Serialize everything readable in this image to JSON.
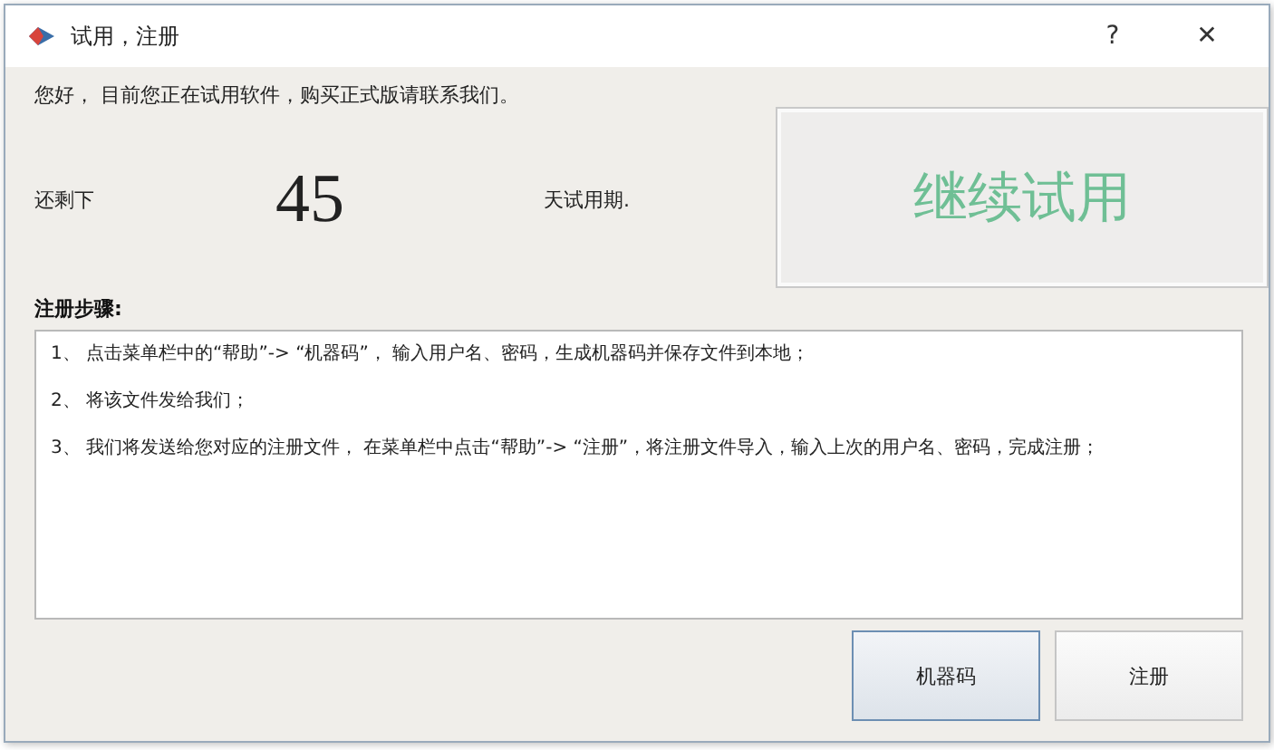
{
  "window": {
    "title": "试用，注册",
    "help": "?",
    "close": "✕"
  },
  "greeting": "您好， 目前您正在试用软件，购买正式版请联系我们。",
  "trial": {
    "prefix": "还剩下",
    "days": "45",
    "suffix": "天试用期."
  },
  "continue_button": "继续试用",
  "steps_heading": "注册步骤:",
  "steps": [
    "1、 点击菜单栏中的“帮助”-> “机器码”， 输入用户名、密码，生成机器码并保存文件到本地；",
    "2、 将该文件发给我们；",
    "3、 我们将发送给您对应的注册文件， 在菜单栏中点击“帮助”-> “注册”，将注册文件导入，输入上次的用户名、密码，完成注册；"
  ],
  "buttons": [
    {
      "label": "机器码",
      "selected": true
    },
    {
      "label": "注册",
      "selected": false
    }
  ]
}
